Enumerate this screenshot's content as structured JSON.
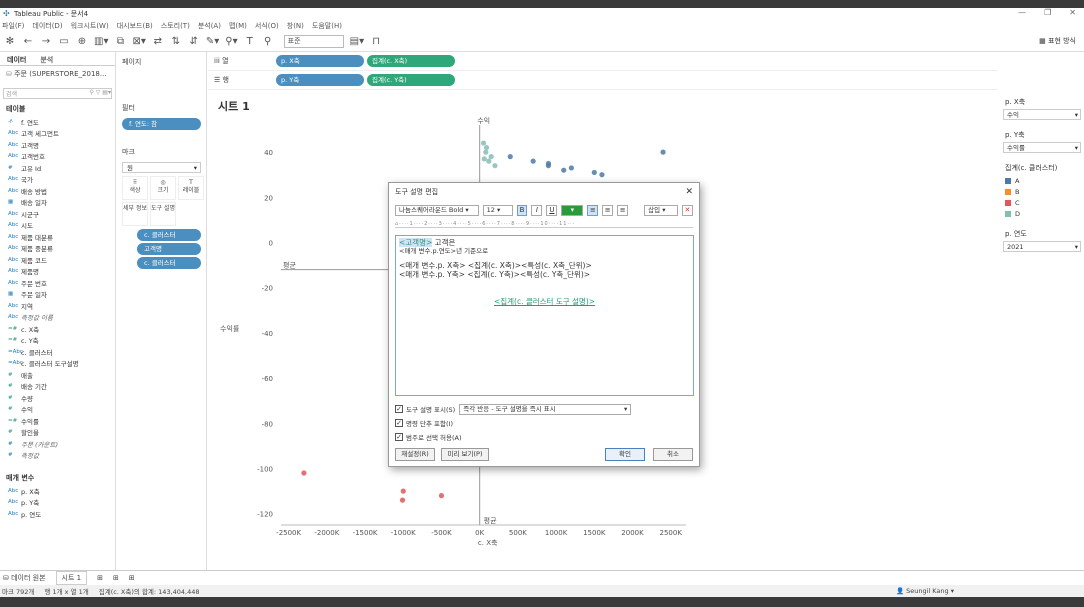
{
  "app": {
    "title": "Tableau Public - 문서4"
  },
  "menu": [
    "파일(F)",
    "데이터(D)",
    "워크시트(W)",
    "대시보드(B)",
    "스토리(T)",
    "분석(A)",
    "맵(M)",
    "서식(O)",
    "창(N)",
    "도움말(H)"
  ],
  "toolbar": {
    "fit": "표준",
    "show_me": "표현 방식"
  },
  "left": {
    "tab_data": "데이터",
    "tab_analysis": "분석",
    "datasource": "주문 (SUPERSTORE_2018...",
    "search_placeholder": "검색",
    "tables_title": "테이블",
    "fields": [
      {
        "type": "-f·",
        "name": "f. 연도",
        "kind": "dim"
      },
      {
        "type": "Abc",
        "name": "고객 세그먼트",
        "kind": "dim"
      },
      {
        "type": "Abc",
        "name": "고객명",
        "kind": "dim"
      },
      {
        "type": "Abc",
        "name": "고객번호",
        "kind": "dim"
      },
      {
        "type": "#",
        "name": "고유 Id",
        "kind": "dim"
      },
      {
        "type": "Abc",
        "name": "국가",
        "kind": "dim"
      },
      {
        "type": "Abc",
        "name": "배송 방법",
        "kind": "dim"
      },
      {
        "type": "▦",
        "name": "배송 일자",
        "kind": "dim"
      },
      {
        "type": "Abc",
        "name": "시군구",
        "kind": "dim"
      },
      {
        "type": "Abc",
        "name": "시도",
        "kind": "dim"
      },
      {
        "type": "Abc",
        "name": "제품 대분류",
        "kind": "dim"
      },
      {
        "type": "Abc",
        "name": "제품 중분류",
        "kind": "dim"
      },
      {
        "type": "Abc",
        "name": "제품 코드",
        "kind": "dim"
      },
      {
        "type": "Abc",
        "name": "제품명",
        "kind": "dim"
      },
      {
        "type": "Abc",
        "name": "주문 번호",
        "kind": "dim"
      },
      {
        "type": "▦",
        "name": "주문 일자",
        "kind": "dim"
      },
      {
        "type": "Abc",
        "name": "지역",
        "kind": "dim"
      },
      {
        "type": "Abc",
        "name": "측정값 이름",
        "kind": "it"
      },
      {
        "type": "=#",
        "name": "c. X축",
        "kind": "meas"
      },
      {
        "type": "=#",
        "name": "c. Y축",
        "kind": "meas"
      },
      {
        "type": "=Abc",
        "name": "c. 클러스터",
        "kind": "dim"
      },
      {
        "type": "=Abc",
        "name": "c. 클러스터 도구설명",
        "kind": "dim"
      },
      {
        "type": "#",
        "name": "매출",
        "kind": "meas"
      },
      {
        "type": "#",
        "name": "배송 기간",
        "kind": "meas"
      },
      {
        "type": "#",
        "name": "수량",
        "kind": "meas"
      },
      {
        "type": "#",
        "name": "수익",
        "kind": "meas"
      },
      {
        "type": "=#",
        "name": "수익률",
        "kind": "meas"
      },
      {
        "type": "#",
        "name": "할인율",
        "kind": "meas"
      },
      {
        "type": "#",
        "name": "주문 (카운트)",
        "kind": "it"
      },
      {
        "type": "#",
        "name": "측정값",
        "kind": "it"
      }
    ],
    "params_title": "매개 변수",
    "params": [
      {
        "type": "Abc",
        "name": "p. X축"
      },
      {
        "type": "Abc",
        "name": "p. Y축"
      },
      {
        "type": "Abc",
        "name": "p. 연도"
      }
    ]
  },
  "cards": {
    "pages": "페이지",
    "filters": "필터",
    "filter_pill": "f. 연도: 참",
    "marks": "마크",
    "mark_type": "원",
    "btn_color": "색상",
    "btn_size": "크기",
    "btn_label": "레이블",
    "btn_detail": "세부 정보",
    "btn_tooltip": "도구 설명",
    "mark_pills": [
      "c. 클러스터",
      "고객명",
      "c. 클러스터"
    ]
  },
  "shelves": {
    "columns_label": "열",
    "rows_label": "행",
    "col_pills": [
      "p. X축",
      "집계(c. X축)"
    ],
    "row_pills": [
      "p. Y축",
      "집계(c. Y축)"
    ]
  },
  "sheet": {
    "title": "시트 1"
  },
  "chart_data": {
    "type": "scatter",
    "title": "",
    "xlabel": "c. X축",
    "ylabel": "수익률",
    "top_label": "수익",
    "ref_label": "평균",
    "x_ticks": [
      "-2500K",
      "-2000K",
      "-1500K",
      "-1000K",
      "-500K",
      "0K",
      "500K",
      "1000K",
      "1500K",
      "2000K",
      "2500K"
    ],
    "y_ticks": [
      "40",
      "20",
      "0",
      "-20",
      "-40",
      "-60",
      "-80",
      "-100",
      "-120"
    ],
    "xlim": [
      -2600,
      2700
    ],
    "ylim": [
      -125,
      52
    ],
    "series": [
      {
        "name": "A",
        "color": "#4e79a7",
        "points": [
          [
            400,
            38
          ],
          [
            700,
            36
          ],
          [
            900,
            35
          ],
          [
            1200,
            33
          ],
          [
            1500,
            31
          ],
          [
            2400,
            40
          ],
          [
            1600,
            30
          ],
          [
            1100,
            32
          ],
          [
            900,
            34
          ]
        ]
      },
      {
        "name": "D",
        "color": "#86bcb6",
        "points": [
          [
            50,
            44
          ],
          [
            80,
            40
          ],
          [
            120,
            36
          ],
          [
            150,
            38
          ],
          [
            200,
            34
          ],
          [
            90,
            42
          ],
          [
            60,
            37
          ]
        ]
      },
      {
        "name": "C",
        "color": "#e15759",
        "points": [
          [
            -2300,
            -102
          ],
          [
            -1000,
            -110
          ],
          [
            -1010,
            -114
          ],
          [
            -500,
            -112
          ]
        ]
      }
    ]
  },
  "right": {
    "px_title": "p. X축",
    "px_value": "수익",
    "py_title": "p. Y축",
    "py_value": "수익률",
    "legend_title": "집계(c. 클러스터)",
    "legend": [
      {
        "label": "A",
        "color": "#4e79a7"
      },
      {
        "label": "B",
        "color": "#f28e2b"
      },
      {
        "label": "C",
        "color": "#e15759"
      },
      {
        "label": "D",
        "color": "#86bcb6"
      }
    ],
    "year_title": "p. 연도",
    "year_value": "2021"
  },
  "dialog": {
    "title": "도구 설명 편집",
    "font": "나눔스퀘어라운드 Bold",
    "size": "12",
    "insert": "삽입",
    "line1_field": "<고객명>",
    "line1_rest": " 고객은",
    "line2": "<매개 변수.p.연도>년 기준으로",
    "line3": "<매개 변수.p. X축> <집계(c. X축)><특성(c. X축_단위)>",
    "line4": "<매개 변수.p. Y축> <집계(c. Y축)><특성(c. Y축_단위)>",
    "line5": "<집계(c. 클러스터 도구 설명)>",
    "opt1": "도구 설명 표시(S)",
    "opt1_sel": "즉각 반응 - 도구 설명을 즉시 표시",
    "opt2": "명령 단추 포함(I)",
    "opt3": "범주로 선택 허용(A)",
    "reset": "재설정(R)",
    "preview": "미리 보기(P)",
    "ok": "확인",
    "cancel": "취소"
  },
  "bottom": {
    "datasource_tab": "데이터 원본",
    "sheet_tab": "시트 1"
  },
  "status": {
    "marks": "마크 792개",
    "rows": "행 1개 x 열 1개",
    "sum": "집계(c. X축)의 합계: 143,404,448",
    "user": "Seungil Kang"
  }
}
